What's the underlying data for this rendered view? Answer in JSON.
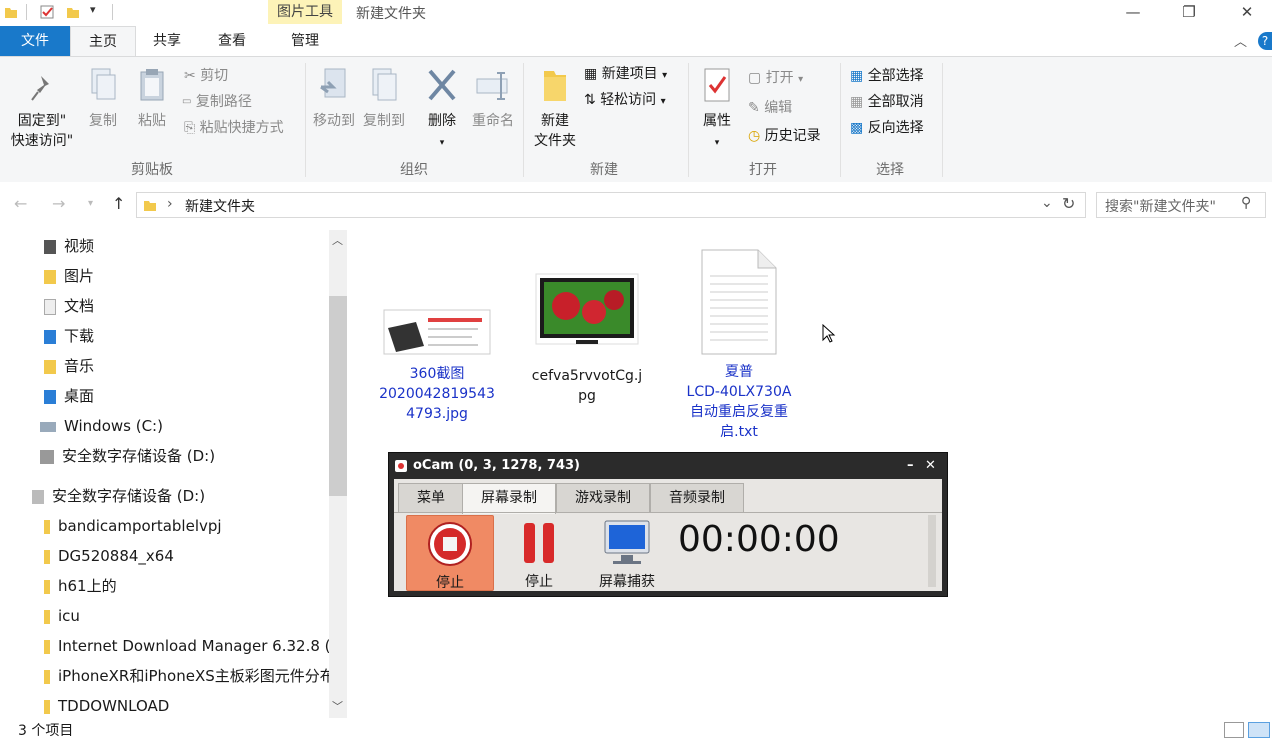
{
  "titlebar": {
    "context_tab": "图片工具",
    "window_title": "新建文件夹",
    "minimize": "—",
    "restore": "❐",
    "close": "✕"
  },
  "tabs": {
    "file": "文件",
    "home": "主页",
    "share": "共享",
    "view": "查看",
    "manage": "管理"
  },
  "ribbon": {
    "clipboard": {
      "pin": "固定到\"\n快速访问\"",
      "pin_l1": "固定到\"",
      "pin_l2": "快速访问\"",
      "copy": "复制",
      "paste": "粘贴",
      "cut": "剪切",
      "copy_path": "复制路径",
      "paste_shortcut": "粘贴快捷方式",
      "label": "剪贴板"
    },
    "organize": {
      "move_to": "移动到",
      "copy_to": "复制到",
      "delete": "删除",
      "rename": "重命名",
      "label": "组织"
    },
    "new": {
      "new_folder_l1": "新建",
      "new_folder_l2": "文件夹",
      "new_item": "新建项目",
      "easy_access": "轻松访问",
      "label": "新建"
    },
    "open": {
      "properties": "属性",
      "open": "打开",
      "edit": "编辑",
      "history": "历史记录",
      "label": "打开"
    },
    "select": {
      "select_all": "全部选择",
      "select_none": "全部取消",
      "invert": "反向选择",
      "label": "选择"
    }
  },
  "address": {
    "path": "新建文件夹",
    "search_placeholder": "搜索\"新建文件夹\""
  },
  "nav": {
    "items": [
      {
        "label": "视频"
      },
      {
        "label": "图片"
      },
      {
        "label": "文档"
      },
      {
        "label": "下载"
      },
      {
        "label": "音乐"
      },
      {
        "label": "桌面"
      },
      {
        "label": "Windows (C:)"
      },
      {
        "label": "安全数字存储设备 (D:)"
      },
      {
        "label": "安全数字存储设备 (D:)"
      },
      {
        "label": "bandicamportablelvpj"
      },
      {
        "label": "DG520884_x64"
      },
      {
        "label": "h61上的"
      },
      {
        "label": "icu"
      },
      {
        "label": "Internet Download Manager 6.32.8 (:"
      },
      {
        "label": "iPhoneXR和iPhoneXS主板彩图元件分布"
      },
      {
        "label": "TDDOWNLOAD"
      }
    ]
  },
  "files": [
    {
      "l1": "360截图",
      "l2": "2020042819543",
      "l3": "4793.jpg"
    },
    {
      "l1": "cefva5rvvotCg.j",
      "l2": "pg"
    },
    {
      "l1": "夏普",
      "l2": "LCD-40LX730A",
      "l3": "自动重启反复重",
      "l4": "启.txt"
    }
  ],
  "status": {
    "count": "3 个项目"
  },
  "ocam": {
    "title": "oCam (0, 3, 1278, 743)",
    "tabs": [
      "菜单",
      "屏幕录制",
      "游戏录制",
      "音频录制"
    ],
    "stop": "停止",
    "pause": "停止",
    "capture": "屏幕捕获",
    "timer": "00:00:00",
    "minimize": "–",
    "close": "✕"
  },
  "colors": {
    "accent": "#1979ca",
    "context_tab": "#fdf3b8",
    "link_text": "#1a32c8",
    "ocam_active": "#f08a64"
  }
}
